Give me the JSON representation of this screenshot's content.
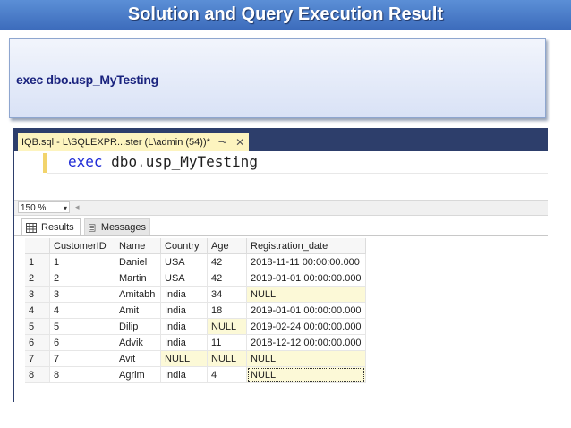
{
  "slide": {
    "title": "Solution and Query Execution Result",
    "solution_text": "exec dbo.usp_MyTesting"
  },
  "ssms": {
    "tab": {
      "title": "IQB.sql - L\\SQLEXPR...ster (L\\admin (54))*",
      "pin_glyph": "⊸",
      "close_glyph": "✕"
    },
    "editor": {
      "keyword": "exec",
      "object": "dbo",
      "dot": ".",
      "proc": "usp_MyTesting"
    },
    "zoom": {
      "value": "150 %",
      "arrow": "▾",
      "scroll_left": "◂"
    },
    "results_tabs": {
      "results_label": "Results",
      "messages_label": "Messages",
      "results_icon": "grid-icon",
      "messages_icon": "messages-icon"
    },
    "grid": {
      "columns": [
        "",
        "CustomerID",
        "Name",
        "Country",
        "Age",
        "Registration_date"
      ],
      "rows": [
        [
          "1",
          "1",
          "Daniel",
          "USA",
          "42",
          "2018-11-11 00:00:00.000"
        ],
        [
          "2",
          "2",
          "Martin",
          "USA",
          "42",
          "2019-01-01 00:00:00.000"
        ],
        [
          "3",
          "3",
          "Amitabh",
          "India",
          "34",
          "NULL"
        ],
        [
          "4",
          "4",
          "Amit",
          "India",
          "18",
          "2019-01-01 00:00:00.000"
        ],
        [
          "5",
          "5",
          "Dilip",
          "India",
          "NULL",
          "2019-02-24 00:00:00.000"
        ],
        [
          "6",
          "6",
          "Advik",
          "India",
          "11",
          "2018-12-12 00:00:00.000"
        ],
        [
          "7",
          "7",
          "Avit",
          "NULL",
          "NULL",
          "NULL"
        ],
        [
          "8",
          "8",
          "Agrim",
          "India",
          "4",
          "NULL"
        ]
      ],
      "null_color": "#fcf9d7"
    }
  },
  "colors": {
    "title_bar": "#3d6cbc",
    "ssms_frame": "#2d3e6b",
    "tab_active": "#fdf4bf",
    "keyword": "#1f2bd6"
  }
}
